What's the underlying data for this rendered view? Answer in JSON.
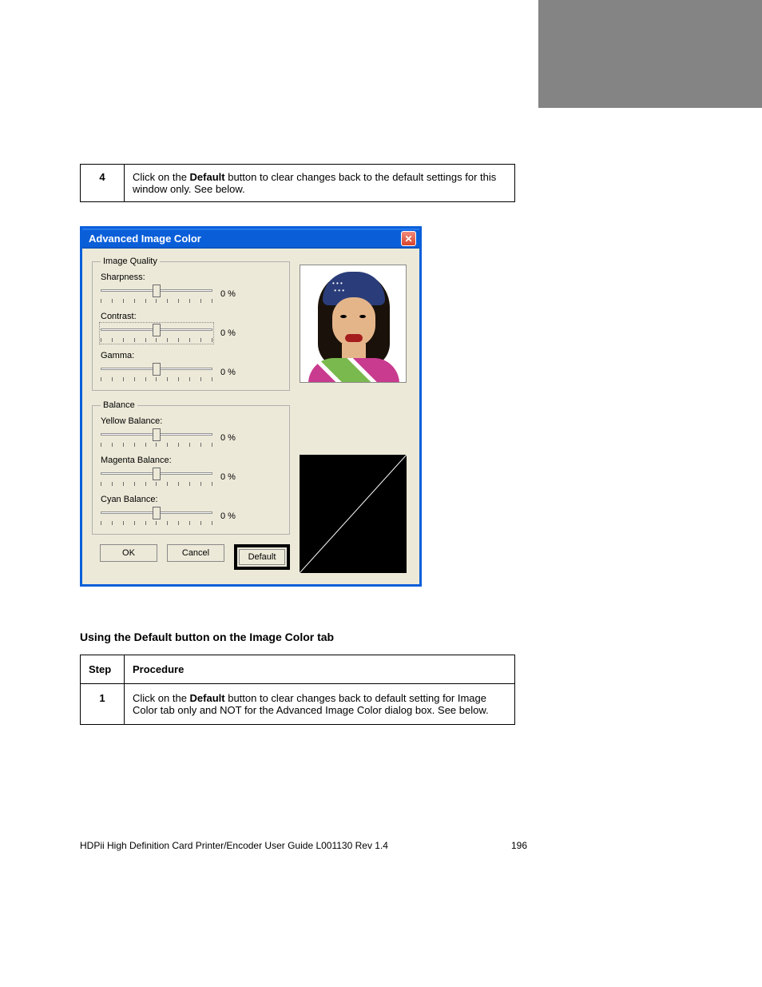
{
  "step1": {
    "num": "4",
    "text_pre": "Click on the ",
    "text_bold": "Default",
    "text_post": " button to clear changes back to the default settings for this window only. See below."
  },
  "dialog": {
    "title": "Advanced Image Color",
    "groups": {
      "quality": {
        "legend": "Image Quality",
        "sliders": [
          {
            "label": "Sharpness:",
            "value": "0  %"
          },
          {
            "label": "Contrast:",
            "value": "0  %"
          },
          {
            "label": "Gamma:",
            "value": "0  %"
          }
        ]
      },
      "balance": {
        "legend": "Balance",
        "sliders": [
          {
            "label": "Yellow Balance:",
            "value": "0  %"
          },
          {
            "label": "Magenta Balance:",
            "value": "0  %"
          },
          {
            "label": "Cyan Balance:",
            "value": "0  %"
          }
        ]
      }
    },
    "buttons": {
      "ok": "OK",
      "cancel": "Cancel",
      "default": "Default"
    }
  },
  "section_heading": "Using the Default button on the Image Color tab",
  "table2": {
    "h1": "Step",
    "h2": "Procedure",
    "num": "1",
    "text_pre": "Click on the ",
    "text_bold": "Default",
    "text_post": " button to clear changes back to default setting for Image Color tab only and NOT for the Advanced Image Color dialog box. See below."
  },
  "footer": {
    "left": "HDPii High Definition Card Printer/Encoder User Guide    L001130 Rev 1.4",
    "right": "196"
  }
}
